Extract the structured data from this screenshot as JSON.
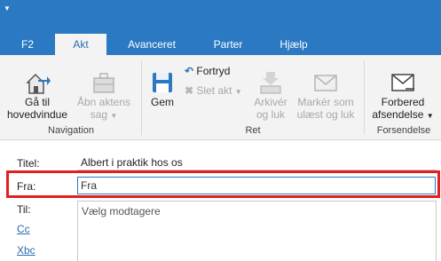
{
  "ribbon_tabs": [
    "F2",
    "Akt",
    "Avanceret",
    "Parter",
    "Hjælp"
  ],
  "active_tab": "Akt",
  "navigation": {
    "goto_line1": "Gå til",
    "goto_line2": "hovedvindue",
    "open_line1": "Åbn aktens",
    "open_line2": "sag",
    "group_label": "Navigation"
  },
  "ret": {
    "save": "Gem",
    "undo": "Fortryd",
    "delete": "Slet akt",
    "archive_line1": "Arkivér",
    "archive_line2": "og luk",
    "mark_line1": "Markér som",
    "mark_line2": "ulæst og luk",
    "group_label": "Ret"
  },
  "forsendelse": {
    "prepare_line1": "Forbered",
    "prepare_line2": "afsendelse",
    "group_label": "Forsendelse"
  },
  "form": {
    "title_label": "Titel:",
    "title_value": "Albert i praktik hos os",
    "from_label": "Fra:",
    "from_placeholder": "Fra",
    "to_label": "Til:",
    "to_placeholder": "Vælg modtagere",
    "cc_label": "Cc",
    "bcc_label": "Xbc"
  },
  "colors": {
    "accent": "#2b79c2",
    "highlight": "#e1201f",
    "link": "#2b6cb0"
  }
}
